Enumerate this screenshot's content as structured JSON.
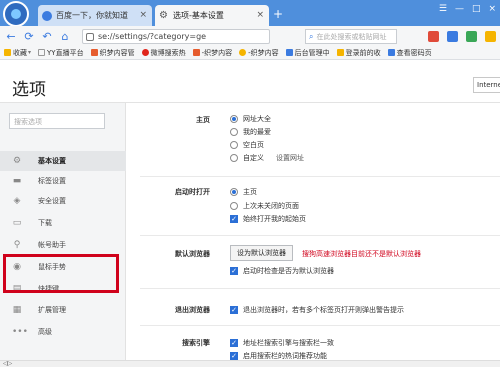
{
  "browser": {
    "tabs": [
      {
        "title": "百度一下，你就知道",
        "close": "×"
      },
      {
        "title": "选项-基本设置",
        "close": "×",
        "icon": "⚙"
      }
    ],
    "new_tab": "+",
    "window_controls": [
      "☰",
      "—",
      "□",
      "×"
    ],
    "nav": {
      "back": "←",
      "forward": "⟳",
      "undo": "↶",
      "home": "⌂"
    },
    "address": "se://settings/?category=ge",
    "search_placeholder": "在此处搜索或粘贴网址",
    "search_icon": "⌕"
  },
  "bookmarks": [
    {
      "label": "收藏",
      "caret": "▾",
      "color": "#f5b400"
    },
    {
      "label": "YY直播平台",
      "color": "#ffffff"
    },
    {
      "label": "织梦内容管",
      "color": "#e65c2e"
    },
    {
      "label": "微博搜索热",
      "color": "#e0251b"
    },
    {
      "label": "-织梦内容",
      "color": "#e65c2e"
    },
    {
      "label": "-织梦内容",
      "color": "#f5b400"
    },
    {
      "label": "后台管理中",
      "color": "#3b7be0"
    },
    {
      "label": "登录前的收",
      "color": "#f5b400"
    },
    {
      "label": "查看密码页",
      "color": "#3b7be0"
    }
  ],
  "page": {
    "title": "选项",
    "engine_select": "Interne",
    "sidebar_search_placeholder": "搜索选项",
    "nav_items": [
      {
        "label": "基本设置",
        "icon": "⚙",
        "active": true
      },
      {
        "label": "标签设置",
        "icon": "▬"
      },
      {
        "label": "安全设置",
        "icon": "◈"
      },
      {
        "label": "下载",
        "icon": "▭"
      },
      {
        "label": "帐号助手",
        "icon": "⚲"
      },
      {
        "label": "鼠标手势",
        "icon": "◉"
      },
      {
        "label": "快捷键",
        "icon": "▤"
      },
      {
        "label": "扩展管理",
        "icon": "▦"
      },
      {
        "label": "高级",
        "icon": "•••"
      }
    ]
  },
  "settings": {
    "homepage": {
      "label": "主页",
      "options": [
        {
          "label": "网址大全",
          "selected": true
        },
        {
          "label": "我的最爱",
          "selected": false
        },
        {
          "label": "空白页",
          "selected": false
        },
        {
          "label": "自定义",
          "selected": false
        }
      ],
      "set_url_link": "设置网址"
    },
    "startup": {
      "label": "启动时打开",
      "options": [
        {
          "label": "主页",
          "selected": true
        },
        {
          "label": "上次未关闭的页面",
          "selected": false
        }
      ],
      "always_open_check": "始终打开我的起始页"
    },
    "default_browser": {
      "label": "默认浏览器",
      "button": "设为默认浏览器",
      "warning": "搜狗高速浏览器目前还不是默认浏览器",
      "check_on_start": "启动时检查是否为默认浏览器"
    },
    "exit_browser": {
      "label": "退出浏览器",
      "warn_check": "退出浏览器时，若有多个标签页打开则弹出警告提示"
    },
    "search_engine": {
      "label": "搜索引擎",
      "options": [
        "地址栏搜索引擎与搜索栏一致",
        "启用搜索栏的热词推荐功能"
      ]
    }
  },
  "statusbar": "◁▷"
}
